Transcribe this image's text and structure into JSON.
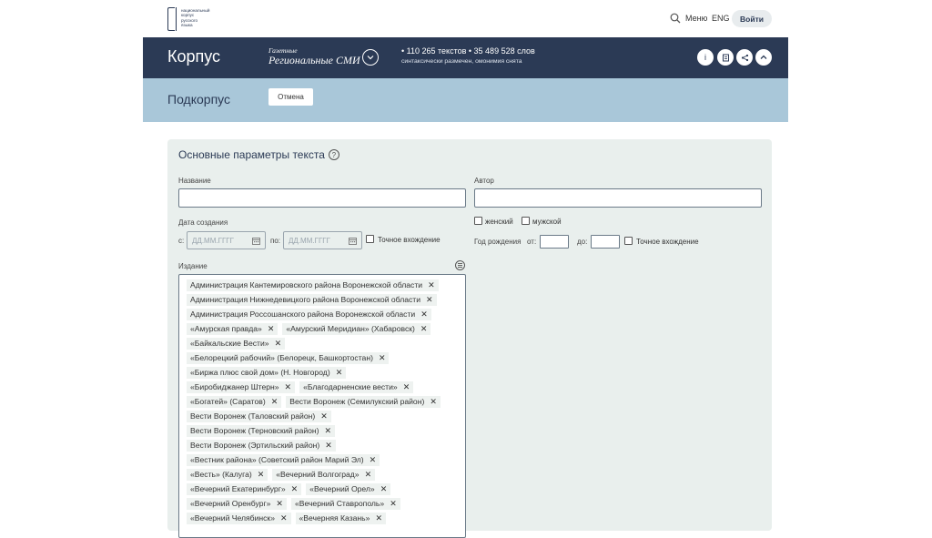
{
  "topbar": {
    "logo_text": [
      "национальный",
      "корпус",
      "русского",
      "языка"
    ],
    "menu": "Меню",
    "lang": "ENG",
    "login": "Войти"
  },
  "header": {
    "corpus": "Корпус",
    "subcorpus_small": "Газетные",
    "subcorpus_big": "Региональные СМИ",
    "stats": "• 110 265 текстов • 35 489 528 слов",
    "stats_sub": "синтаксически размечен, омонимия снята"
  },
  "subband": {
    "title": "Подкорпус",
    "cancel": "Отмена"
  },
  "form": {
    "title": "Основные параметры текста",
    "name_label": "Название",
    "author_label": "Автор",
    "date_label": "Дата создания",
    "from_label": "с:",
    "to_label": "по:",
    "date_placeholder": "ДД.ММ.ГГГГ",
    "exact": "Точное вхождение",
    "female": "женский",
    "male": "мужской",
    "birth_year": "Год рождения",
    "birth_from": "от:",
    "birth_to": "до:",
    "edition_label": "Издание"
  },
  "editions": [
    [
      "Администрация Кантемировского района Воронежской области"
    ],
    [
      "Администрация Нижнедевицкого района Воронежской области"
    ],
    [
      "Администрация Россошанского района Воронежской области"
    ],
    [
      "«Амурская правда»",
      "«Амурский Меридиан» (Хабаровск)"
    ],
    [
      "«Байкальские Вести»"
    ],
    [
      "«Белорецкий рабочий» (Белорецк, Башкортостан)"
    ],
    [
      "«Биржа плюс свой дом» (Н. Новгород)"
    ],
    [
      "«Биробиджанер Штерн»",
      "«Благодарненские вести»"
    ],
    [
      "«Богатей» (Саратов)",
      "Вести Воронеж (Семилукский район)"
    ],
    [
      "Вести Воронеж (Таловский район)"
    ],
    [
      "Вести Воронеж (Терновский район)"
    ],
    [
      "Вести Воронеж (Эртильский район)"
    ],
    [
      "«Вестник района» (Советский район Марий Эл)"
    ],
    [
      "«Весть» (Калуга)",
      "«Вечерний Волгоград»"
    ],
    [
      "«Вечерний Екатеринбург»",
      "«Вечерний Орел»"
    ],
    [
      "«Вечерний Оренбург»",
      "«Вечерний Ставрополь»"
    ],
    [
      "«Вечерний Челябинск»",
      "«Вечерняя Казань»"
    ]
  ]
}
